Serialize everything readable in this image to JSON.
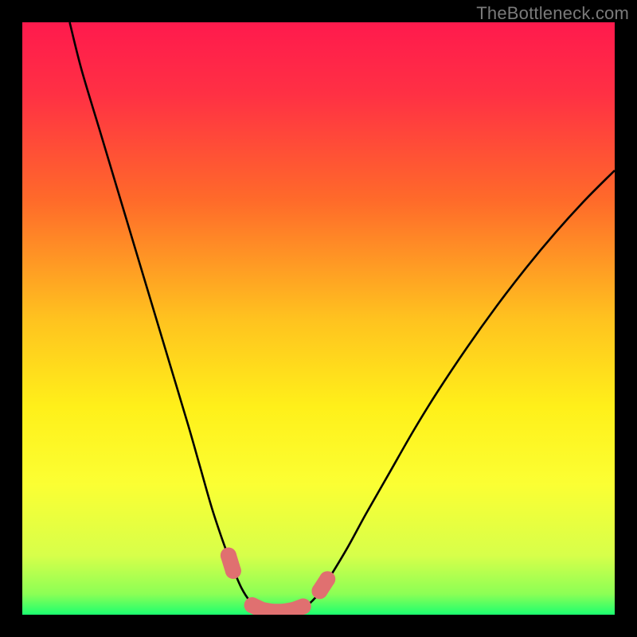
{
  "watermark": "TheBottleneck.com",
  "chart_data": {
    "type": "line",
    "title": "",
    "xlabel": "",
    "ylabel": "",
    "xlim": [
      0,
      100
    ],
    "ylim": [
      0,
      100
    ],
    "gradient_stops": [
      {
        "offset": 0.0,
        "color": "#ff1a4d"
      },
      {
        "offset": 0.12,
        "color": "#ff3044"
      },
      {
        "offset": 0.3,
        "color": "#ff6a2a"
      },
      {
        "offset": 0.5,
        "color": "#ffc21f"
      },
      {
        "offset": 0.65,
        "color": "#fff01a"
      },
      {
        "offset": 0.78,
        "color": "#fbff33"
      },
      {
        "offset": 0.9,
        "color": "#d7ff4a"
      },
      {
        "offset": 0.965,
        "color": "#8cff55"
      },
      {
        "offset": 1.0,
        "color": "#1cff70"
      }
    ],
    "series": [
      {
        "name": "left-curve",
        "stroke": "#000000",
        "points": [
          {
            "x": 8.0,
            "y": 100.0
          },
          {
            "x": 10.0,
            "y": 92.0
          },
          {
            "x": 13.0,
            "y": 82.0
          },
          {
            "x": 16.0,
            "y": 72.0
          },
          {
            "x": 19.0,
            "y": 62.0
          },
          {
            "x": 22.0,
            "y": 52.0
          },
          {
            "x": 25.0,
            "y": 42.0
          },
          {
            "x": 28.0,
            "y": 32.0
          },
          {
            "x": 30.0,
            "y": 25.0
          },
          {
            "x": 32.0,
            "y": 18.0
          },
          {
            "x": 34.0,
            "y": 12.0
          },
          {
            "x": 35.5,
            "y": 8.0
          },
          {
            "x": 37.0,
            "y": 4.5
          },
          {
            "x": 38.5,
            "y": 2.2
          },
          {
            "x": 40.0,
            "y": 1.0
          },
          {
            "x": 42.0,
            "y": 0.4
          },
          {
            "x": 44.0,
            "y": 0.3
          }
        ]
      },
      {
        "name": "right-curve",
        "stroke": "#000000",
        "points": [
          {
            "x": 44.0,
            "y": 0.3
          },
          {
            "x": 46.0,
            "y": 0.5
          },
          {
            "x": 48.0,
            "y": 1.5
          },
          {
            "x": 50.0,
            "y": 3.5
          },
          {
            "x": 52.0,
            "y": 6.5
          },
          {
            "x": 55.0,
            "y": 11.5
          },
          {
            "x": 58.0,
            "y": 17.0
          },
          {
            "x": 62.0,
            "y": 24.0
          },
          {
            "x": 66.0,
            "y": 31.0
          },
          {
            "x": 70.0,
            "y": 37.5
          },
          {
            "x": 75.0,
            "y": 45.0
          },
          {
            "x": 80.0,
            "y": 52.0
          },
          {
            "x": 85.0,
            "y": 58.5
          },
          {
            "x": 90.0,
            "y": 64.5
          },
          {
            "x": 95.0,
            "y": 70.0
          },
          {
            "x": 100.0,
            "y": 75.0
          }
        ]
      },
      {
        "name": "markers",
        "stroke": "#e07070",
        "style": "thick-dots",
        "points": [
          {
            "x": 34.8,
            "y": 10.0
          },
          {
            "x": 35.6,
            "y": 7.4
          },
          {
            "x": 38.8,
            "y": 1.6
          },
          {
            "x": 40.5,
            "y": 0.8
          },
          {
            "x": 42.2,
            "y": 0.5
          },
          {
            "x": 44.0,
            "y": 0.5
          },
          {
            "x": 45.8,
            "y": 0.8
          },
          {
            "x": 47.4,
            "y": 1.4
          },
          {
            "x": 50.2,
            "y": 4.0
          },
          {
            "x": 51.5,
            "y": 6.0
          }
        ]
      }
    ]
  }
}
